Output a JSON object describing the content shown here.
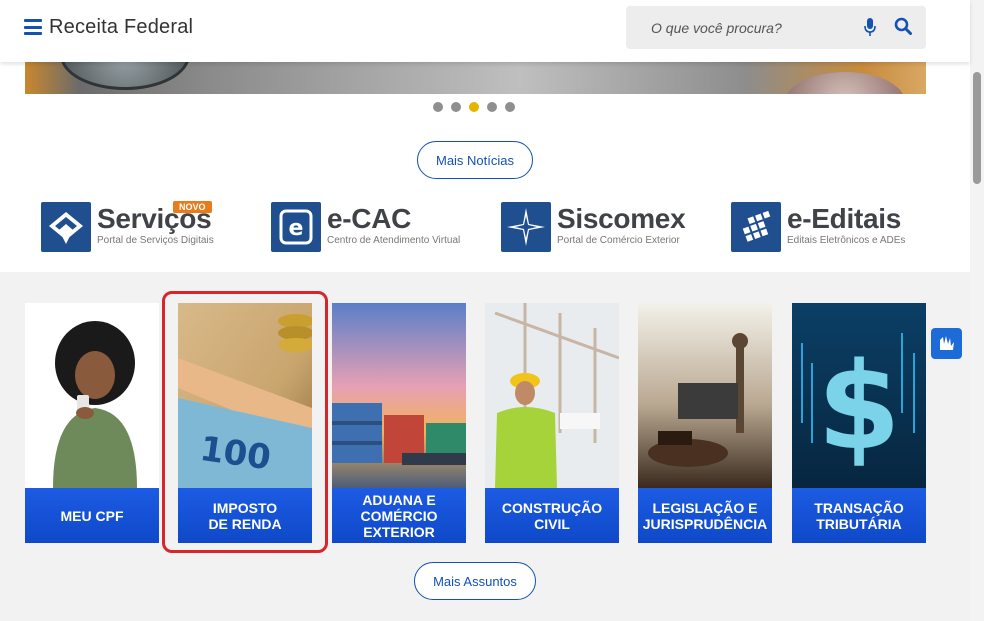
{
  "header": {
    "brand": "Receita Federal",
    "search_placeholder": "O que você procura?"
  },
  "carousel": {
    "dot_count": 5,
    "active_index": 2,
    "news_button": "Mais Notícias"
  },
  "portals": [
    {
      "name": "Serviços",
      "subtitle": "Portal de Serviços Digitais",
      "badge": "NOVO"
    },
    {
      "name": "e-CAC",
      "subtitle": "Centro de Atendimento Virtual"
    },
    {
      "name": "Siscomex",
      "subtitle": "Portal de Comércio Exterior"
    },
    {
      "name": "e-Editais",
      "subtitle": "Editais Eletrônicos e ADEs"
    }
  ],
  "topics": [
    {
      "label": "MEU CPF"
    },
    {
      "label": "IMPOSTO\nDE RENDA",
      "highlighted": true
    },
    {
      "label": "ADUANA E\nCOMÉRCIO\nEXTERIOR"
    },
    {
      "label": "CONSTRUÇÃO\nCIVIL"
    },
    {
      "label": "LEGISLAÇÃO E\nJURISPRUDÊNCIA"
    },
    {
      "label": "TRANSAÇÃO\nTRIBUTÁRIA"
    }
  ],
  "topics_button": "Mais Assuntos",
  "colors": {
    "primary_blue": "#1351b4",
    "card_blue": "#1351d8",
    "active_dot": "#e5b500",
    "highlight_red": "#d7262b",
    "badge_orange": "#e87b1a"
  }
}
